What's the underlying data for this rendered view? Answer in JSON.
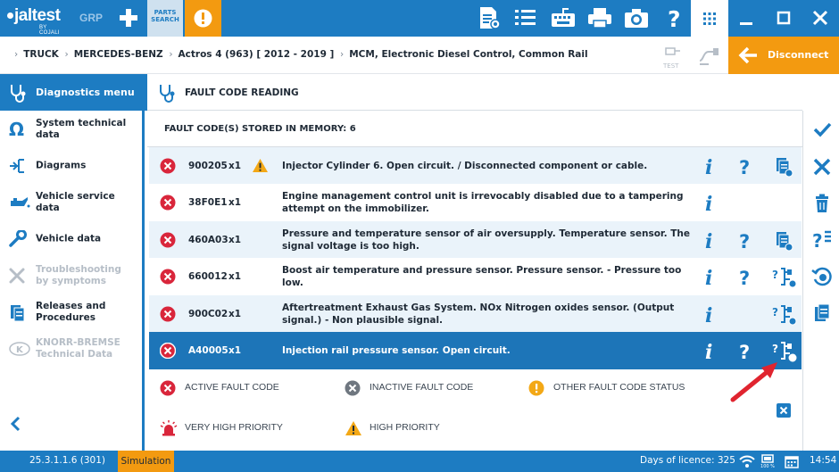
{
  "topbar": {
    "brand": "jaltest",
    "brand_sub": "BY COJALI",
    "grp": "GRP",
    "parts_line1": "PARTS",
    "parts_line2": "SEARCH",
    "icons": [
      "report-icon",
      "list-icon",
      "keyboard-icon",
      "printer-icon",
      "camera-icon",
      "help-icon",
      "apps-grid-icon",
      "minimize-icon",
      "maximize-icon",
      "close-icon"
    ]
  },
  "breadcrumb": {
    "items": [
      "TRUCK",
      "MERCEDES-BENZ",
      "Actros 4 (963) [ 2012 - 2019 ]",
      "MCM, Electronic Diesel Control, Common Rail"
    ],
    "test_label": "TEST",
    "disconnect_label": "Disconnect"
  },
  "sidebar": {
    "header": "Diagnostics menu",
    "items": [
      {
        "label": "System technical data",
        "icon": "omega-icon",
        "disabled": false
      },
      {
        "label": "Diagrams",
        "icon": "connector-icon",
        "disabled": false
      },
      {
        "label": "Vehicle service data",
        "icon": "oil-can-icon",
        "disabled": false
      },
      {
        "label": "Vehicle data",
        "icon": "wrench-icon",
        "disabled": false
      },
      {
        "label": "Troubleshooting by symptoms",
        "icon": "tools-icon",
        "disabled": true
      },
      {
        "label": "Releases and Procedures",
        "icon": "documents-icon",
        "disabled": false
      },
      {
        "label": "KNORR-BREMSE Technical Data",
        "icon": "knorr-logo-icon",
        "disabled": true
      }
    ]
  },
  "main": {
    "title": "FAULT CODE READING",
    "count_label": "FAULT CODE(S) STORED IN MEMORY: 6"
  },
  "faults": [
    {
      "code": "900205",
      "count": "x1",
      "priority": "high",
      "desc": "Injector Cylinder 6. Open circuit. / Disconnected component or cable.",
      "info": true,
      "help": true,
      "doc": "doc"
    },
    {
      "code": "38F0E1",
      "count": "x1",
      "priority": "",
      "desc": "Engine management control unit is irrevocably disabled due to a tampering attempt on the immobilizer.",
      "info": true,
      "help": false,
      "doc": ""
    },
    {
      "code": "460A03",
      "count": "x1",
      "priority": "",
      "desc": "Pressure and temperature sensor of air oversupply. Temperature sensor. The signal voltage is too high.",
      "info": true,
      "help": true,
      "doc": "doc"
    },
    {
      "code": "660012",
      "count": "x1",
      "priority": "",
      "desc": "Boost air temperature and pressure sensor. Pressure sensor. - Pressure too low.",
      "info": true,
      "help": true,
      "doc": "troubleshoot"
    },
    {
      "code": "900C02",
      "count": "x1",
      "priority": "",
      "desc": "Aftertreatment Exhaust Gas System. NOx Nitrogen oxides sensor. (Output signal.) - Non plausible signal.",
      "info": true,
      "help": false,
      "doc": "troubleshoot"
    },
    {
      "code": "A40005",
      "count": "x1",
      "priority": "",
      "desc": "Injection rail pressure sensor. Open circuit.",
      "info": true,
      "help": true,
      "doc": "troubleshoot",
      "selected": true
    }
  ],
  "legend": {
    "active": "ACTIVE FAULT CODE",
    "inactive": "INACTIVE FAULT CODE",
    "other": "OTHER FAULT CODE STATUS",
    "very_high": "VERY HIGH PRIORITY",
    "high": "HIGH PRIORITY"
  },
  "rightbar": {
    "icons": [
      "check-icon",
      "close-icon",
      "trash-icon",
      "help-options-icon",
      "erase-codes-icon",
      "copy-docs-icon"
    ]
  },
  "statusbar": {
    "version": "25.3.1.1.6 (301)",
    "mode": "Simulation",
    "licence": "Days of licence: 325",
    "battery": "100 %",
    "time": "14:54"
  },
  "colors": {
    "primary": "#1d7cc2",
    "accent": "#f39a10",
    "error": "#d9263b",
    "selected_row": "#1d75b8",
    "row_alt": "#eaf3fa"
  }
}
